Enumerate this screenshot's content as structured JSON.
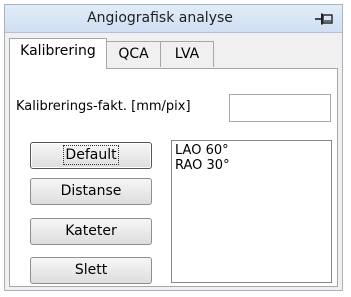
{
  "window": {
    "title": "Angiografisk analyse"
  },
  "tabs": [
    {
      "label": "Kalibrering",
      "active": true
    },
    {
      "label": "QCA",
      "active": false
    },
    {
      "label": "LVA",
      "active": false
    }
  ],
  "calibration": {
    "label": "Kalibrerings-fakt. [mm/pix]",
    "value": ""
  },
  "buttons": [
    {
      "label": "Default"
    },
    {
      "label": "Distanse"
    },
    {
      "label": "Kateter"
    },
    {
      "label": "Slett"
    }
  ],
  "list": {
    "items": [
      "LAO 60°",
      "RAO 30°"
    ]
  },
  "icons": {
    "pin": "pin-icon"
  }
}
